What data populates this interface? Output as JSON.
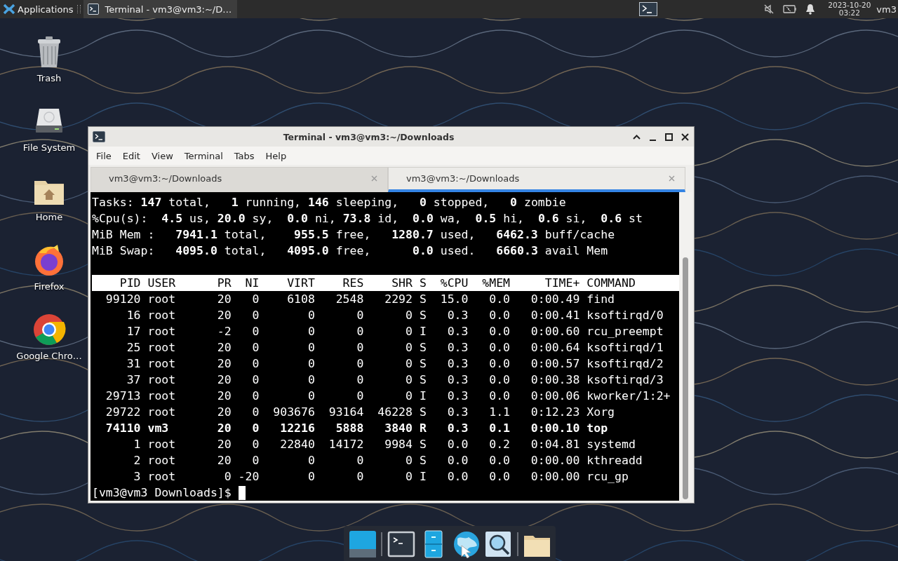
{
  "panel": {
    "app_menu": "Applications",
    "tasks": [
      {
        "title": "Terminal - vm3@vm3:~/D…",
        "selected": true
      }
    ],
    "clock": {
      "date": "2023-10-20",
      "time": "03:22"
    },
    "user": "vm3"
  },
  "desktop_icons": [
    {
      "label": "Trash",
      "kind": "trash"
    },
    {
      "label": "File System",
      "kind": "drive"
    },
    {
      "label": "Home",
      "kind": "home"
    },
    {
      "label": "Firefox",
      "kind": "firefox"
    },
    {
      "label": "Google Chro…",
      "kind": "chrome"
    }
  ],
  "terminal": {
    "title": "Terminal - vm3@vm3:~/Downloads",
    "menu": [
      "File",
      "Edit",
      "View",
      "Terminal",
      "Tabs",
      "Help"
    ],
    "tabs": [
      {
        "label": "vm3@vm3:~/Downloads",
        "selected": false
      },
      {
        "label": "vm3@vm3:~/Downloads",
        "selected": true
      }
    ],
    "summary": [
      "Tasks: **147** total,   **1** running, **146** sleeping,   **0** stopped,   **0** zombie",
      "%Cpu(s):  **4.5** us, **20.0** sy,  **0.0** ni, **73.8** id,  **0.0** wa,  **0.5** hi,  **0.6** si,  **0.6** st",
      "MiB Mem :   **7941.1** total,    **955.5** free,   **1280.7** used,   **6462.3** buff/cache",
      "MiB Swap:   **4095.0** total,   **4095.0** free,      **0.0** used.   **6660.3** avail Mem"
    ],
    "header": "    PID USER      PR  NI    VIRT    RES    SHR S  %CPU  %MEM     TIME+ COMMAND",
    "processes": [
      {
        "text": "  99120 root      20   0    6108   2548   2292 S  15.0   0.0   0:00.49 find",
        "bold": false
      },
      {
        "text": "     16 root      20   0       0      0      0 S   0.3   0.0   0:00.41 ksoftirqd/0",
        "bold": false
      },
      {
        "text": "     17 root      -2   0       0      0      0 I   0.3   0.0   0:00.60 rcu_preempt",
        "bold": false
      },
      {
        "text": "     25 root      20   0       0      0      0 S   0.3   0.0   0:00.64 ksoftirqd/1",
        "bold": false
      },
      {
        "text": "     31 root      20   0       0      0      0 S   0.3   0.0   0:00.57 ksoftirqd/2",
        "bold": false
      },
      {
        "text": "     37 root      20   0       0      0      0 S   0.3   0.0   0:00.38 ksoftirqd/3",
        "bold": false
      },
      {
        "text": "  29713 root      20   0       0      0      0 I   0.3   0.0   0:00.06 kworker/1:2+",
        "bold": false
      },
      {
        "text": "  29722 root      20   0  903676  93164  46228 S   0.3   1.1   0:12.23 Xorg",
        "bold": false
      },
      {
        "text": "  74110 vm3       20   0   12216   5888   3840 R   0.3   0.1   0:00.10 top",
        "bold": true
      },
      {
        "text": "      1 root      20   0   22840  14172   9984 S   0.0   0.2   0:04.81 systemd",
        "bold": false
      },
      {
        "text": "      2 root      20   0       0      0      0 S   0.0   0.0   0:00.00 kthreadd",
        "bold": false
      },
      {
        "text": "      3 root       0 -20       0      0      0 I   0.0   0.0   0:00.00 rcu_gp",
        "bold": false
      }
    ],
    "prompt": "[vm3@vm3 Downloads]$"
  },
  "dock": [
    {
      "kind": "desktop"
    },
    {
      "kind": "separator"
    },
    {
      "kind": "terminal"
    },
    {
      "kind": "files"
    },
    {
      "kind": "browser"
    },
    {
      "kind": "search"
    },
    {
      "kind": "separator"
    },
    {
      "kind": "folder"
    }
  ]
}
